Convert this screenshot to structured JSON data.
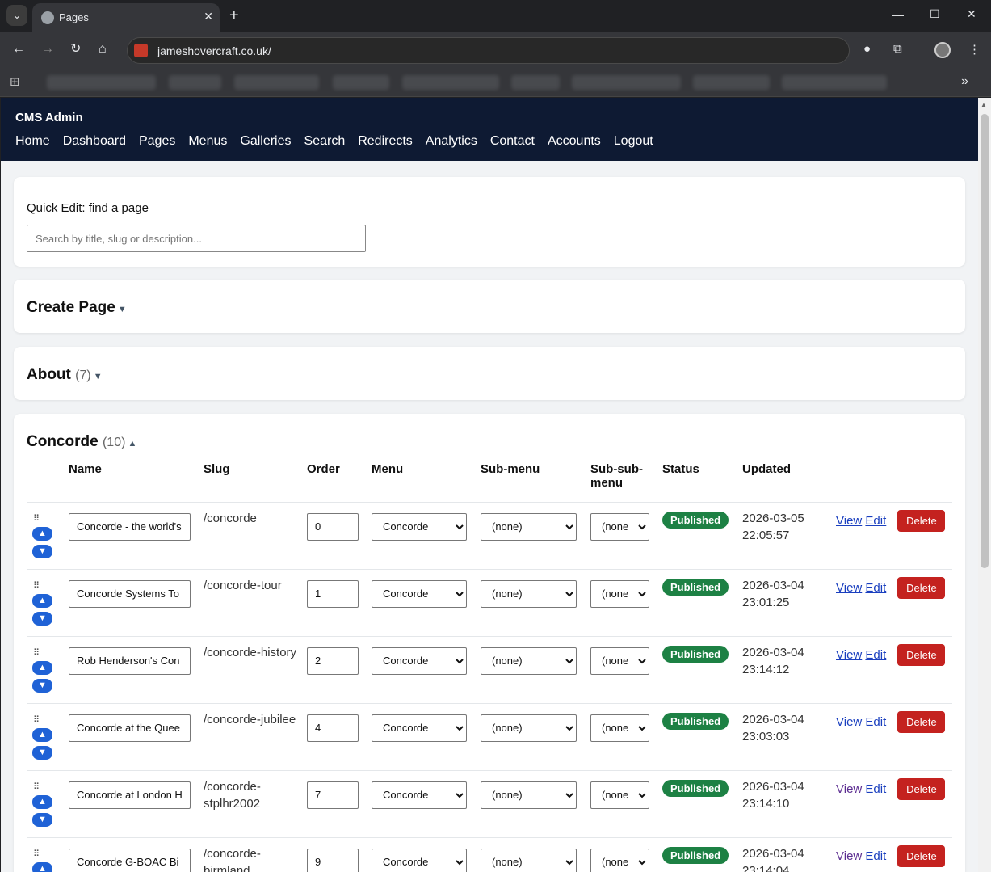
{
  "browser": {
    "tab_title": "Pages",
    "url": "jameshovercraft.co.uk/"
  },
  "header": {
    "brand": "CMS Admin",
    "nav": [
      "Home",
      "Dashboard",
      "Pages",
      "Menus",
      "Galleries",
      "Search",
      "Redirects",
      "Analytics",
      "Contact",
      "Accounts",
      "Logout"
    ]
  },
  "quick_edit": {
    "label": "Quick Edit: find a page",
    "placeholder": "Search by title, slug or description..."
  },
  "create_page": {
    "title": "Create Page"
  },
  "about": {
    "title": "About",
    "count": "(7)"
  },
  "concorde": {
    "title": "Concorde",
    "count": "(10)",
    "columns": [
      "Name",
      "Slug",
      "Order",
      "Menu",
      "Sub-menu",
      "Sub-sub-menu",
      "Status",
      "Updated"
    ],
    "rows": [
      {
        "name": "Concorde - the world's",
        "slug": "/concorde",
        "order": "0",
        "menu": "Concorde",
        "sub": "(none)",
        "subsub": "(none",
        "status": "Published",
        "updated_date": "2026-03-05",
        "updated_time": "22:05:57",
        "view": "View",
        "edit": "Edit",
        "delete": "Delete"
      },
      {
        "name": "Concorde Systems To",
        "slug": "/concorde-tour",
        "order": "1",
        "menu": "Concorde",
        "sub": "(none)",
        "subsub": "(none",
        "status": "Published",
        "updated_date": "2026-03-04",
        "updated_time": "23:01:25",
        "view": "View",
        "edit": "Edit",
        "delete": "Delete"
      },
      {
        "name": "Rob Henderson's Con",
        "slug": "/concorde-history",
        "order": "2",
        "menu": "Concorde",
        "sub": "(none)",
        "subsub": "(none",
        "status": "Published",
        "updated_date": "2026-03-04",
        "updated_time": "23:14:12",
        "view": "View",
        "edit": "Edit",
        "delete": "Delete"
      },
      {
        "name": "Concorde at the Quee",
        "slug": "/concorde-jubilee",
        "order": "4",
        "menu": "Concorde",
        "sub": "(none)",
        "subsub": "(none",
        "status": "Published",
        "updated_date": "2026-03-04",
        "updated_time": "23:03:03",
        "view": "View",
        "edit": "Edit",
        "delete": "Delete"
      },
      {
        "name": "Concorde at London H",
        "slug": "/concorde-stplhr2002",
        "order": "7",
        "menu": "Concorde",
        "sub": "(none)",
        "subsub": "(none",
        "status": "Published",
        "updated_date": "2026-03-04",
        "updated_time": "23:14:10",
        "view": "View",
        "edit": "Edit",
        "delete": "Delete"
      },
      {
        "name": "Concorde G-BOAC Bi",
        "slug": "/concorde-birmland",
        "order": "9",
        "menu": "Concorde",
        "sub": "(none)",
        "subsub": "(none",
        "status": "Published",
        "updated_date": "2026-03-04",
        "updated_time": "23:14:04",
        "view": "View",
        "edit": "Edit",
        "delete": "Delete"
      }
    ]
  }
}
